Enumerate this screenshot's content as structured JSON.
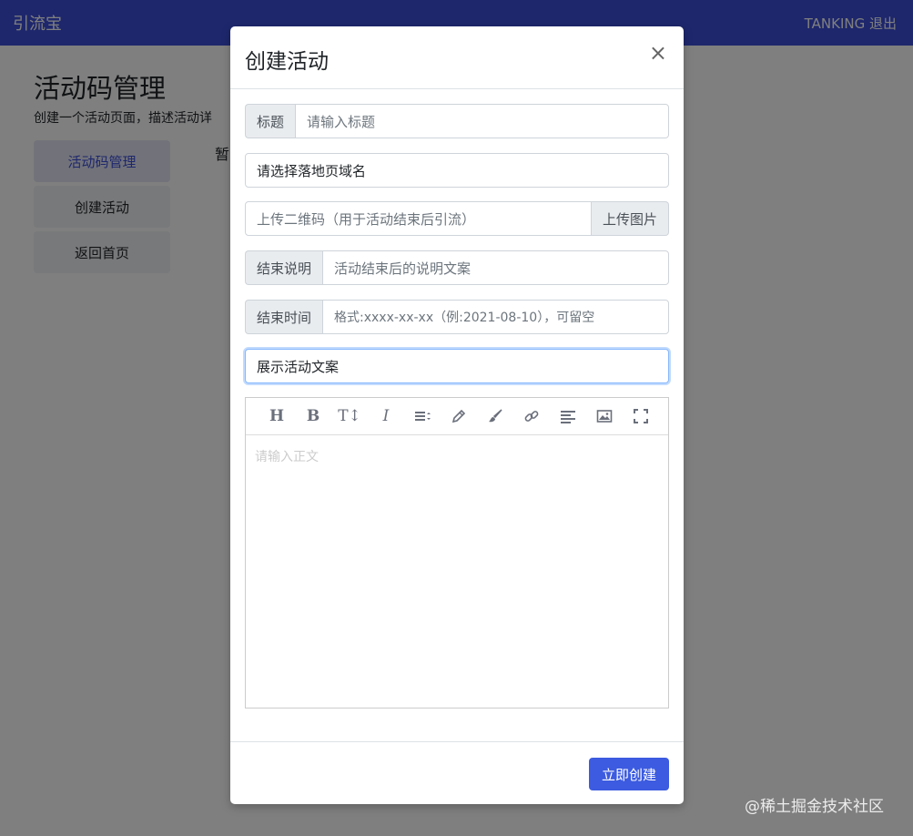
{
  "navbar": {
    "brand": "引流宝",
    "right": "TANKING 退出"
  },
  "page": {
    "title": "活动码管理",
    "description": "创建一个活动页面，描述活动详",
    "empty_text": "暂"
  },
  "sidebar": {
    "items": [
      {
        "label": "活动码管理"
      },
      {
        "label": "创建活动"
      },
      {
        "label": "返回首页"
      }
    ]
  },
  "modal": {
    "title": "创建活动",
    "close": "×",
    "title_field": {
      "label": "标题",
      "placeholder": "请输入标题"
    },
    "domain_select": {
      "value": "请选择落地页域名"
    },
    "qrcode_field": {
      "placeholder": "上传二维码（用于活动结束后引流）",
      "button": "上传图片"
    },
    "end_desc_field": {
      "label": "结束说明",
      "placeholder": "活动结束后的说明文案"
    },
    "end_time_field": {
      "label": "结束时间",
      "placeholder": "格式:xxxx-xx-xx（例:2021-08-10），可留空"
    },
    "display_select": {
      "value": "展示活动文案"
    },
    "editor": {
      "placeholder": "请输入正文",
      "tools": [
        "heading-icon",
        "bold-icon",
        "text-size-icon",
        "italic-icon",
        "align-icon",
        "pen-icon",
        "brush-icon",
        "link-icon",
        "paragraph-icon",
        "image-icon",
        "fullscreen-icon"
      ]
    },
    "submit": "立即创建"
  },
  "watermark": "@稀土掘金技术社区",
  "colors": {
    "primary": "#3c4fd9",
    "button": "#3c5be0"
  }
}
